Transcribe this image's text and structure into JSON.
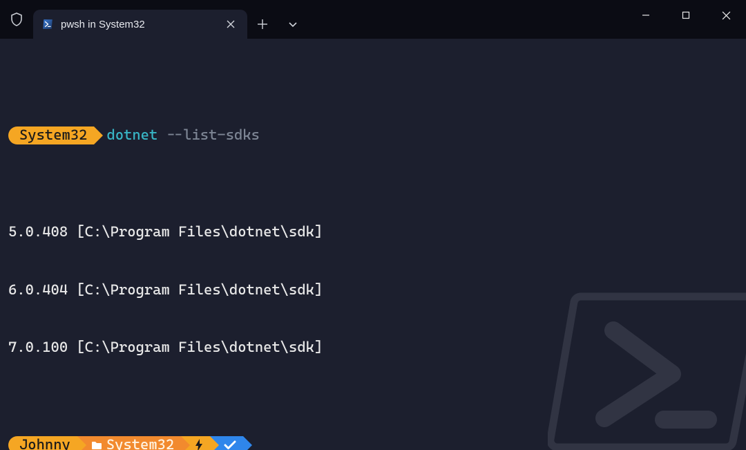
{
  "window": {
    "tab_title": "pwsh in System32",
    "shield_icon": "shield",
    "tab_icon": "powershell",
    "newtab_label": "+",
    "dropdown_label": "⌄"
  },
  "prompt1": {
    "location": "System32",
    "command_exe": "dotnet",
    "command_arg": "--list-sdks"
  },
  "output_lines": [
    "5.0.408 [C:\\Program Files\\dotnet\\sdk]",
    "6.0.404 [C:\\Program Files\\dotnet\\sdk]",
    "7.0.100 [C:\\Program Files\\dotnet\\sdk]"
  ],
  "prompt2": {
    "user": "Johnny",
    "location": "System32",
    "admin_icon": "bolt",
    "status_icon": "check"
  },
  "colors": {
    "bg": "#1c1f2e",
    "gold": "#f5a623",
    "orange": "#f28a2e",
    "blue": "#2f86eb",
    "cyan": "#38b6c6",
    "dim": "#7d8594"
  }
}
